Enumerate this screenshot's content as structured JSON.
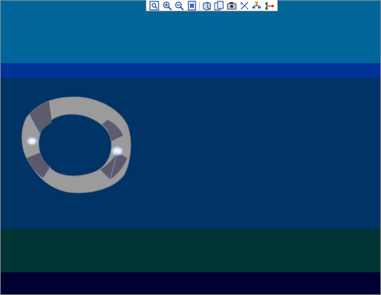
{
  "viewer": {
    "background_bands": [
      "#006699",
      "#003399",
      "#003366",
      "#003333",
      "#000033"
    ],
    "model_colors": {
      "body": "#9c9c9c",
      "shade": "#5a5a6e",
      "highlight": "#e8f0ff",
      "accent": "#7fa0ff"
    }
  },
  "toolbar": {
    "buttons": [
      {
        "icon": "zoom-to-fit-icon"
      },
      {
        "icon": "zoom-in-icon"
      },
      {
        "icon": "zoom-out-icon"
      },
      {
        "icon": "page-setup-icon"
      },
      {
        "icon": "view-orientation-icon"
      },
      {
        "icon": "copy-view-icon"
      },
      {
        "icon": "camera-icon"
      },
      {
        "icon": "measure-icon"
      },
      {
        "icon": "tree-icon"
      },
      {
        "icon": "connector-icon"
      }
    ]
  }
}
